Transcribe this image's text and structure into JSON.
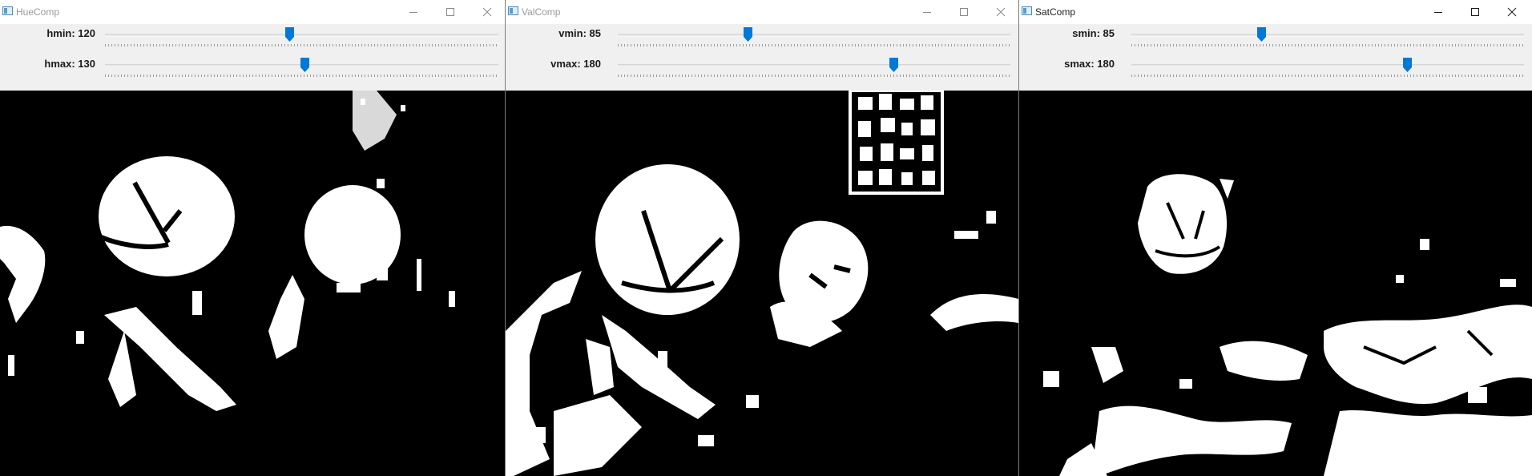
{
  "windows": [
    {
      "title": "HueComp",
      "trackbars": [
        {
          "label": "hmin: 120",
          "position": 0.469
        },
        {
          "label": "hmax: 130",
          "position": 0.508
        }
      ]
    },
    {
      "title": "ValComp",
      "trackbars": [
        {
          "label": "vmin: 85",
          "position": 0.332
        },
        {
          "label": "vmax: 180",
          "position": 0.703
        }
      ]
    },
    {
      "title": "SatComp",
      "trackbars": [
        {
          "label": "smin: 85",
          "position": 0.332
        },
        {
          "label": "smax: 180",
          "position": 0.703
        }
      ]
    }
  ],
  "colors": {
    "thumb": "#0078d7",
    "image_foreground": "#ffffff",
    "image_background": "#000000"
  },
  "icons": {
    "minimize": "minimize-icon",
    "maximize": "maximize-icon",
    "close": "close-icon"
  }
}
